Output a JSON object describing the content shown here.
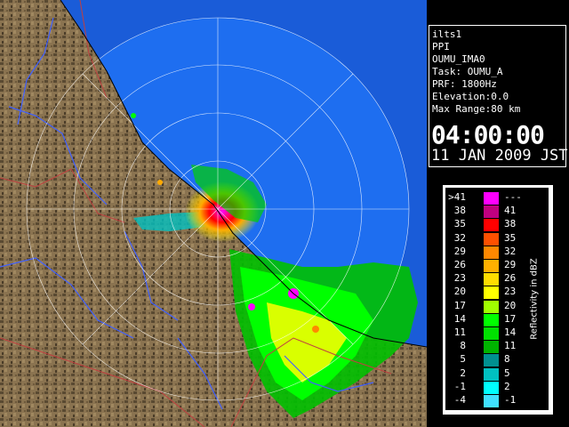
{
  "info": {
    "lines": [
      "ilts1",
      "PPI",
      "OUMU_IMA0",
      "Task: OUMU_A",
      "PRF: 1800Hz",
      "Elevation:0.0",
      "Max Range:80 km"
    ],
    "time": "04:00:00",
    "date": "11 JAN 2009 JST"
  },
  "legend": {
    "caption": "Reflectivity in dBZ",
    "rows": [
      {
        "low": ">41",
        "high": "---",
        "color": "#ff00ff"
      },
      {
        "low": "38",
        "high": "41",
        "color": "#c00080"
      },
      {
        "low": "35",
        "high": "38",
        "color": "#ff0000"
      },
      {
        "low": "32",
        "high": "35",
        "color": "#ff5000"
      },
      {
        "low": "29",
        "high": "32",
        "color": "#ff8800"
      },
      {
        "low": "26",
        "high": "29",
        "color": "#ffb000"
      },
      {
        "low": "23",
        "high": "26",
        "color": "#ffdd00"
      },
      {
        "low": "20",
        "high": "23",
        "color": "#ffff00"
      },
      {
        "low": "17",
        "high": "20",
        "color": "#a0ff00"
      },
      {
        "low": "14",
        "high": "17",
        "color": "#00ff00"
      },
      {
        "low": "11",
        "high": "14",
        "color": "#00e000"
      },
      {
        "low": "8",
        "high": "11",
        "color": "#00b400"
      },
      {
        "low": "5",
        "high": "8",
        "color": "#009090"
      },
      {
        "low": "2",
        "high": "5",
        "color": "#00c0c0"
      },
      {
        "low": "-1",
        "high": "2",
        "color": "#00ffff"
      },
      {
        "low": "-4",
        "high": "-1",
        "color": "#40e0ff"
      }
    ]
  },
  "colors": {
    "sea": "#1e6ef0",
    "outer_sea": "#1a5cd8",
    "land": "#8a7350",
    "land_dark": "#5a4a32",
    "range_rings": "#ffffff",
    "rivers": "#4060ff",
    "borders": "#c04040"
  }
}
